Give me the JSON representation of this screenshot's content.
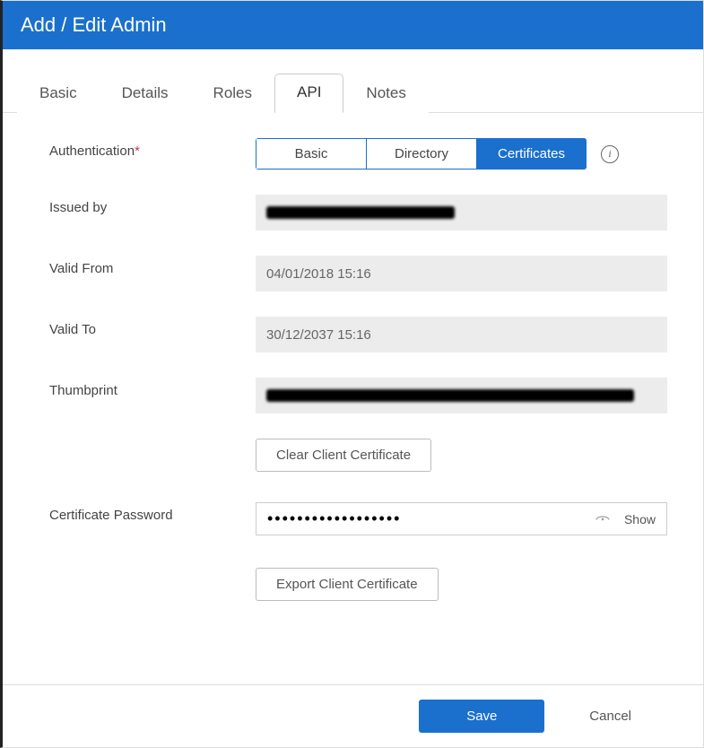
{
  "header": {
    "title": "Add / Edit Admin"
  },
  "tabs": {
    "items": [
      {
        "label": "Basic"
      },
      {
        "label": "Details"
      },
      {
        "label": "Roles"
      },
      {
        "label": "API"
      },
      {
        "label": "Notes"
      }
    ],
    "active_index": 3
  },
  "form": {
    "authentication": {
      "label": "Authentication",
      "required_mark": "*",
      "options": [
        {
          "label": "Basic"
        },
        {
          "label": "Directory"
        },
        {
          "label": "Certificates"
        }
      ],
      "active_index": 2
    },
    "issued_by": {
      "label": "Issued by",
      "value": ""
    },
    "valid_from": {
      "label": "Valid From",
      "value": "04/01/2018 15:16"
    },
    "valid_to": {
      "label": "Valid To",
      "value": "30/12/2037 15:16"
    },
    "thumbprint": {
      "label": "Thumbprint",
      "value": ""
    },
    "clear_cert_button": "Clear Client Certificate",
    "cert_password": {
      "label": "Certificate Password",
      "value": "••••••••••••••••••",
      "show_label": "Show"
    },
    "export_cert_button": "Export Client Certificate"
  },
  "footer": {
    "save": "Save",
    "cancel": "Cancel"
  }
}
